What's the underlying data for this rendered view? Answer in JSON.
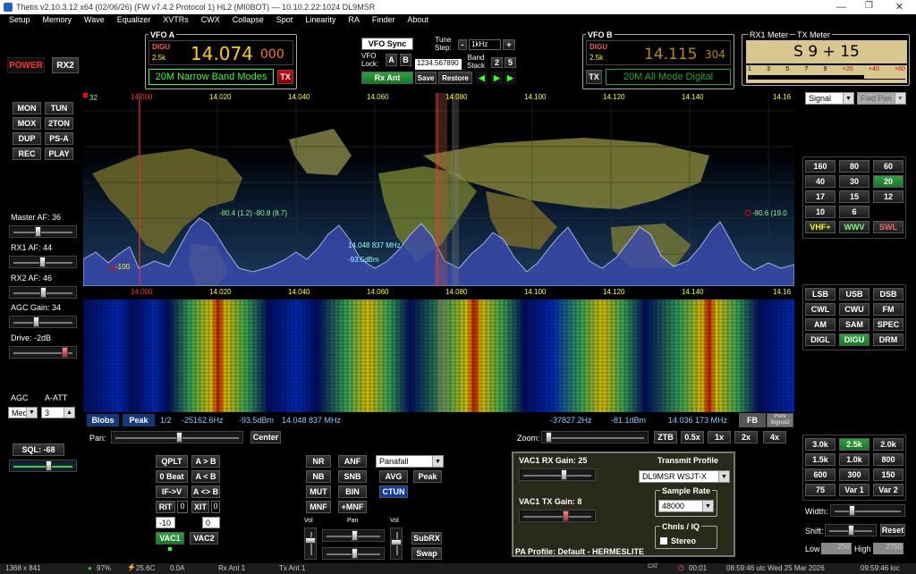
{
  "titlebar": {
    "title": "Thetis v2.10.3.12 x64 (02/06/26) (FW v7.4.2 Protocol 1) HL2 (MI0BOT)  —  10.10.2.22:1024   DL9MSR"
  },
  "menu": [
    "Setup",
    "Memory",
    "Wave",
    "Equalizer",
    "XVTRs",
    "CWX",
    "Collapse",
    "Spot",
    "Linearity",
    "RA",
    "Finder",
    "About"
  ],
  "vfo_a": {
    "label": "VFO A",
    "mode": "DIGU",
    "bw": "2.5k",
    "freq_main": "14.074",
    "freq_sub": "000",
    "band_text": "20M Narrow Band Modes",
    "tx": "TX"
  },
  "vfo_b": {
    "label": "VFO B",
    "mode": "DIGU",
    "bw": "2.5k",
    "freq_main": "14.115",
    "freq_sub": "304",
    "band_text": "20M All Mode Digital",
    "tx": "TX"
  },
  "vfo_ctrl": {
    "sync": "VFO Sync",
    "lock": "VFO\nLock:",
    "a": "A",
    "b": "B",
    "lock_value": "1234.567890",
    "tune_step": "Tune\nStep:",
    "step_value": "1kHz",
    "band_stack": "Band\nStack",
    "bs2": "2",
    "bs5": "5",
    "rx_ant": "Rx Ant",
    "save": "Save",
    "restore": "Restore"
  },
  "meter": {
    "rx_label": "RX1 Meter",
    "tx_label": "TX Meter",
    "reading": "S 9 + 15",
    "scale": [
      "1",
      "3",
      "5",
      "7",
      "9",
      "+20",
      "+40",
      "+60"
    ],
    "sel1": "Signal",
    "sel2": "Fwd Pwr"
  },
  "left": {
    "power": "POWER",
    "rx2": "RX2",
    "buttons": [
      [
        "MON",
        "TUN"
      ],
      [
        "MOX",
        "2TON"
      ],
      [
        "DUP",
        "PS-A"
      ],
      [
        "REC",
        "PLAY"
      ]
    ],
    "master": "Master AF:  36",
    "rx1af": "RX1 AF:  44",
    "rx2af": "RX2 AF:  46",
    "agcgain": "AGC Gain:  34",
    "drive": "Drive:  -2dB",
    "agc": "AGC",
    "aatt": "A-ATT",
    "agc_val": "Med",
    "att_val": "3",
    "sql": "SQL:  -68"
  },
  "spectrum": {
    "ticks": [
      "14.000",
      "14.020",
      "14.040",
      "14.060",
      "14.080",
      "14.100",
      "14.120",
      "14.140",
      "14.16"
    ],
    "top_db": "32",
    "bottom_db": "-100",
    "marker_left": "-80.4 (1.2)  -80.8 (8.7)",
    "marker_right": "-80.6 (19.0",
    "cursor_freq": "14.048 837 MHz",
    "cursor_db": "-93.5dBm"
  },
  "status_bar": {
    "blobs": "Blobs",
    "peak": "Peak",
    "page": "1/2",
    "hz1": "-25162.6Hz",
    "dbm1": "-93.5dBm",
    "freq1": "14.048 837 MHz",
    "hz2": "-37827.2Hz",
    "dbm2": "-81.1dBm",
    "freq2": "14.036 173 MHz",
    "fb": "FB",
    "pure": "Pure\nSignal2"
  },
  "pan": {
    "label": "Pan:",
    "center": "Center",
    "zoom": "Zoom:",
    "zbtns": [
      "ZTB",
      "0.5x",
      "1x",
      "2x",
      "4x"
    ]
  },
  "rit": {
    "qplt": "QPLT",
    "atob": "A > B",
    "zerobeat": "0 Beat",
    "btoa": "A < B",
    "ifv": "IF->V",
    "aswap": "A <> B",
    "rit": "RIT",
    "rit_val": "0",
    "xit": "XIT",
    "xit_val": "0",
    "v1": "-10",
    "v2": "0",
    "vac1": "VAC1",
    "vac2": "VAC2"
  },
  "dsp": {
    "nr": "NR",
    "anf": "ANF",
    "nb": "NB",
    "snb": "SNB",
    "mut": "MUT",
    "bin": "BIN",
    "mnf": "MNF",
    "pmnf": "+MNF",
    "display": "Panafall",
    "avg": "AVG",
    "peak": "Peak",
    "ctun": "CTUN",
    "vol": "Vol",
    "pan": "Pan",
    "vol2": "Vol",
    "subrx": "SubRX",
    "swap": "Swap"
  },
  "vac": {
    "rx": "VAC1 RX Gain:  25",
    "tx": "VAC1 TX Gain:  8",
    "tp_label": "Transmit Profile",
    "tp_value": "DL9MSR WSJT-X",
    "sr_label": "Sample Rate",
    "sr_value": "48000",
    "chnl": "Chnls / IQ",
    "stereo": "Stereo",
    "pa": "PA Profile: Default - HERMESLITE"
  },
  "bands": [
    [
      "160",
      "80",
      "60"
    ],
    [
      "40",
      "30",
      "20"
    ],
    [
      "17",
      "15",
      "12"
    ],
    [
      "10",
      "6",
      ""
    ],
    [
      "VHF+",
      "WWV",
      "SWL"
    ]
  ],
  "modes": [
    [
      "LSB",
      "USB",
      "DSB"
    ],
    [
      "CWL",
      "CWU",
      "FM"
    ],
    [
      "AM",
      "SAM",
      "SPEC"
    ],
    [
      "DIGL",
      "DIGU",
      "DRM"
    ]
  ],
  "filters": [
    [
      "3.0k",
      "2.5k",
      "2.0k"
    ],
    [
      "1.5k",
      "1.0k",
      "800"
    ],
    [
      "600",
      "300",
      "150"
    ],
    [
      "75",
      "Var 1",
      "Var 2"
    ]
  ],
  "filter_ctrl": {
    "width": "Width:",
    "shift": "Shift:",
    "reset": "Reset",
    "low": "Low",
    "low_val": "250",
    "high": "High",
    "high_val": "2750"
  },
  "bottom": {
    "res": "1368 x 841",
    "cpu": "97%",
    "temp": "25.6C",
    "amp": "0.0A",
    "rxant": "Rx Ant 1",
    "txant": "Tx Ant 1",
    "cat": "CAT",
    "timer": "00:01",
    "utc": "08:59:46 utc  Wed 25 Mar 2026",
    "loc": "09:59:46 loc"
  },
  "colors": {
    "accent_green": "#2fa040",
    "freq_yellow": "#ffd000",
    "band_green": "#3f3",
    "spectrum_fill": "#3a4ab0"
  }
}
